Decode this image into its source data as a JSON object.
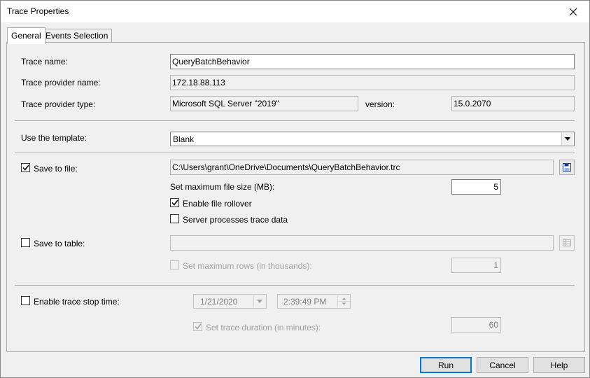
{
  "window": {
    "title": "Trace Properties"
  },
  "tabs": [
    {
      "label": "General"
    },
    {
      "label": "Events Selection"
    }
  ],
  "general": {
    "trace_name_label": "Trace name:",
    "trace_name_value": "QueryBatchBehavior",
    "provider_name_label": "Trace provider name:",
    "provider_name_value": "172.18.88.113",
    "provider_type_label": "Trace provider type:",
    "provider_type_value": "Microsoft SQL Server \"2019\"",
    "version_label": "version:",
    "version_value": "15.0.2070",
    "template_label": "Use the template:",
    "template_value": "Blank",
    "save_to_file_label": "Save to file:",
    "save_to_file_checked": true,
    "file_path": "C:\\Users\\grant\\OneDrive\\Documents\\QueryBatchBehavior.trc",
    "max_file_size_label": "Set maximum file size (MB):",
    "max_file_size_value": "5",
    "enable_rollover_label": "Enable file rollover",
    "enable_rollover_checked": true,
    "server_processes_label": "Server processes trace data",
    "server_processes_checked": false,
    "save_to_table_label": "Save to table:",
    "save_to_table_checked": false,
    "max_rows_label": "Set maximum rows (in thousands):",
    "max_rows_value": "1",
    "stop_time_label": "Enable trace stop time:",
    "stop_time_checked": false,
    "stop_date": "1/21/2020",
    "stop_time": "2:39:49 PM",
    "duration_label": "Set trace duration (in minutes):",
    "duration_checked": true,
    "duration_value": "60"
  },
  "buttons": {
    "run": "Run",
    "cancel": "Cancel",
    "help": "Help"
  },
  "colors": {
    "accent": "#0078d7",
    "dialog_bg": "#f0f0f0",
    "disabled_text": "#a0a0a0"
  }
}
